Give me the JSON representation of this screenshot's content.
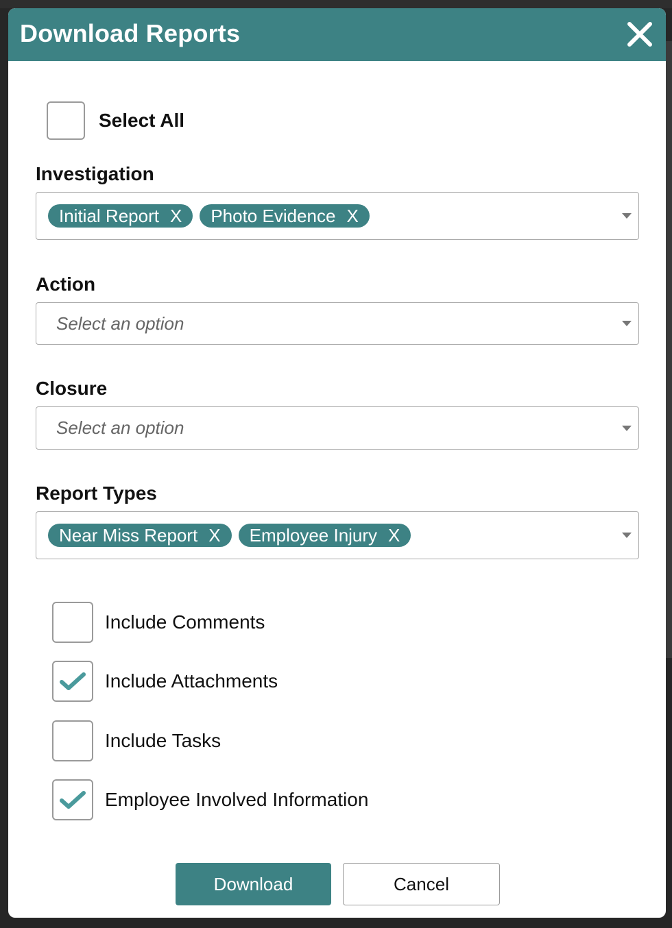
{
  "modal": {
    "title": "Download Reports",
    "close_icon": "close-icon"
  },
  "select_all": {
    "label": "Select All",
    "checked": false
  },
  "sections": {
    "investigation": {
      "label": "Investigation",
      "chips": [
        "Initial Report",
        "Photo Evidence"
      ],
      "chip_remove": "X"
    },
    "action": {
      "label": "Action",
      "placeholder": "Select an option"
    },
    "closure": {
      "label": "Closure",
      "placeholder": "Select an option"
    },
    "report_types": {
      "label": "Report Types",
      "chips": [
        "Near Miss Report",
        "Employee Injury"
      ],
      "chip_remove": "X"
    }
  },
  "options": [
    {
      "label": "Include Comments",
      "checked": false
    },
    {
      "label": "Include Attachments",
      "checked": true
    },
    {
      "label": "Include Tasks",
      "checked": false
    },
    {
      "label": "Employee Involved Information",
      "checked": true
    }
  ],
  "buttons": {
    "download": "Download",
    "cancel": "Cancel"
  },
  "colors": {
    "accent": "#3d8284",
    "check": "#4a9a9c",
    "border": "#aaaaaa"
  }
}
